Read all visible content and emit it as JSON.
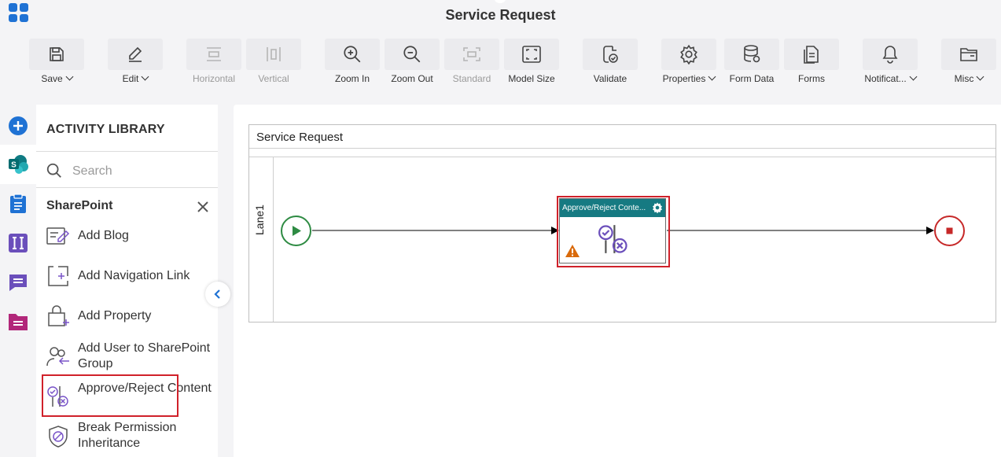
{
  "app": {
    "title": "Service Request"
  },
  "toolbar": {
    "save": "Save",
    "edit": "Edit",
    "horizontal": "Horizontal",
    "vertical": "Vertical",
    "zoom_in": "Zoom In",
    "zoom_out": "Zoom Out",
    "standard": "Standard",
    "model_size": "Model Size",
    "validate": "Validate",
    "properties": "Properties",
    "form_data": "Form Data",
    "forms": "Forms",
    "notifications": "Notificat...",
    "misc": "Misc"
  },
  "library": {
    "heading": "ACTIVITY LIBRARY",
    "search_placeholder": "Search",
    "category": "SharePoint",
    "items": [
      {
        "label": "Add Blog",
        "icon": "add-blog-icon"
      },
      {
        "label": "Add Navigation Link",
        "icon": "add-navigation-link-icon"
      },
      {
        "label": "Add Property",
        "icon": "add-property-icon"
      },
      {
        "label": "Add User to SharePoint Group",
        "icon": "add-user-group-icon"
      },
      {
        "label": "Approve/Reject Content",
        "icon": "approve-reject-icon",
        "highlighted": true
      },
      {
        "label": "Break Permission Inheritance",
        "icon": "break-permission-icon"
      }
    ]
  },
  "canvas": {
    "pool_title": "Service Request",
    "lane_label": "Lane1",
    "task_title": "Approve/Reject Conte...",
    "task_warning": true
  },
  "colors": {
    "accent_blue": "#1f72d4",
    "task_header": "#167a82",
    "start_green": "#2e8b43",
    "end_red": "#c62828",
    "highlight_red": "#d0212a",
    "purple": "#6b4fbb",
    "magenta": "#b2277a",
    "warning_orange": "#d96a0b"
  }
}
